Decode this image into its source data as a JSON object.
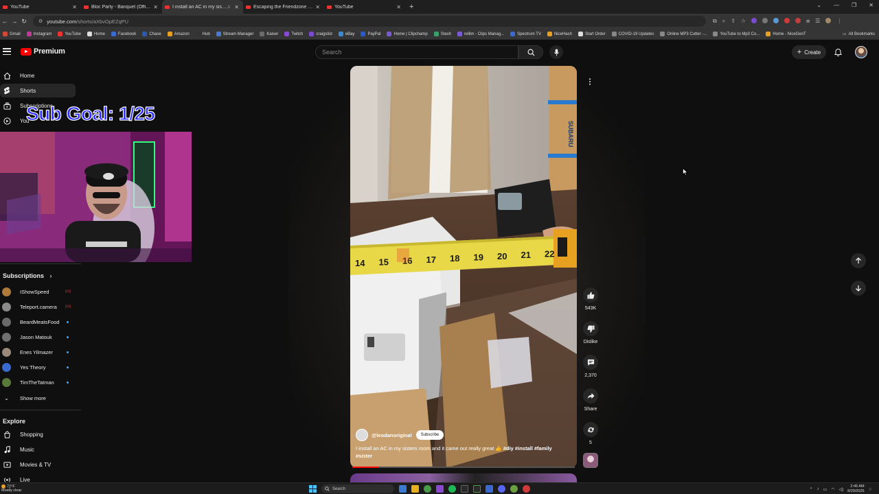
{
  "browser": {
    "tabs": [
      {
        "title": "YouTube",
        "active": false,
        "audio": false
      },
      {
        "title": "Bloc Party - Banquet (Official M",
        "active": false,
        "audio": false
      },
      {
        "title": "I install an AC in my sister",
        "active": true,
        "audio": true
      },
      {
        "title": "Escaping the Friendzone - YouT",
        "active": false,
        "audio": false
      },
      {
        "title": "YouTube",
        "active": false,
        "audio": false
      }
    ],
    "url_host": "youtube.com",
    "url_path": "/shorts/aXbvOpEZqPU",
    "bookmarks": [
      "Gmail",
      "Instagram",
      "YouTube",
      "Home",
      "Facebook",
      "Chase",
      "Amazon",
      "Hub",
      "Stream Manager",
      "Kaiser",
      "Twitch",
      "craigslist",
      "eBay",
      "PayPal",
      "Home | Clipchamp",
      "Stash",
      "rellim - Clips Manag...",
      "Spectrum TV",
      "NiceHash",
      "Start Order",
      "COVID-19 Updates",
      "Online MP3 Cutter -...",
      "YouTube to Mp3 Co...",
      "Home - NiceGenT"
    ],
    "all_bookmarks": "All Bookmarks"
  },
  "header": {
    "logo_text": "Premium",
    "search_placeholder": "Search",
    "create_label": "Create"
  },
  "sidebar": {
    "items": [
      {
        "label": "Home",
        "icon": "home-icon",
        "active": false
      },
      {
        "label": "Shorts",
        "icon": "shorts-icon",
        "active": true
      },
      {
        "label": "Subscriptions",
        "icon": "subscriptions-icon",
        "active": false
      },
      {
        "label": "You",
        "icon": "you-icon",
        "active": false
      }
    ],
    "subscriptions_title": "Subscriptions",
    "subscriptions": [
      {
        "name": "IShowSpeed",
        "color": "#b07a3a",
        "status": "live"
      },
      {
        "name": "Teleport.camera",
        "color": "#8a8a8a",
        "status": "live"
      },
      {
        "name": "BeardMeatsFood",
        "color": "#6a6a6a",
        "status": "dot"
      },
      {
        "name": "Jason Matouk",
        "color": "#707070",
        "status": "dot"
      },
      {
        "name": "Enes Yilmazer",
        "color": "#9a8a7a",
        "status": "dot"
      },
      {
        "name": "Yes Theory",
        "color": "#3a6ad0",
        "status": "dot"
      },
      {
        "name": "TimTheTatman",
        "color": "#5a7a3a",
        "status": "dot"
      }
    ],
    "show_more": "Show more",
    "explore_title": "Explore",
    "explore": [
      {
        "label": "Shopping",
        "icon": "shopping-icon"
      },
      {
        "label": "Music",
        "icon": "music-icon"
      },
      {
        "label": "Movies & TV",
        "icon": "movies-icon"
      },
      {
        "label": "Live",
        "icon": "live-icon"
      }
    ]
  },
  "overlay": {
    "sub_goal": "Sub Goal: 1/25"
  },
  "short": {
    "channel": "@leodanoriginal",
    "subscribe_label": "Subscribe",
    "title_plain": "I install an AC in my sisters room and it came out really great 👍 ",
    "title_tags": "#diy #install #family #sister",
    "progress": 0.12,
    "tape_numbers": [
      "14",
      "15",
      "16",
      "17",
      "18",
      "19",
      "20",
      "21",
      "22"
    ],
    "box_brand": "SUBARU"
  },
  "actions": {
    "likes": "543K",
    "dislike": "Dislike",
    "comments": "2,370",
    "share": "Share",
    "remix": "5"
  },
  "taskbar": {
    "temp": "72°F",
    "condition": "Mostly clear",
    "search": "Search",
    "time": "2:46 AM",
    "date": "8/29/2025"
  },
  "colors": {
    "yt_red": "#ff0000",
    "link_blue": "#3ea6ff",
    "sub_goal": "#2d2dff"
  }
}
